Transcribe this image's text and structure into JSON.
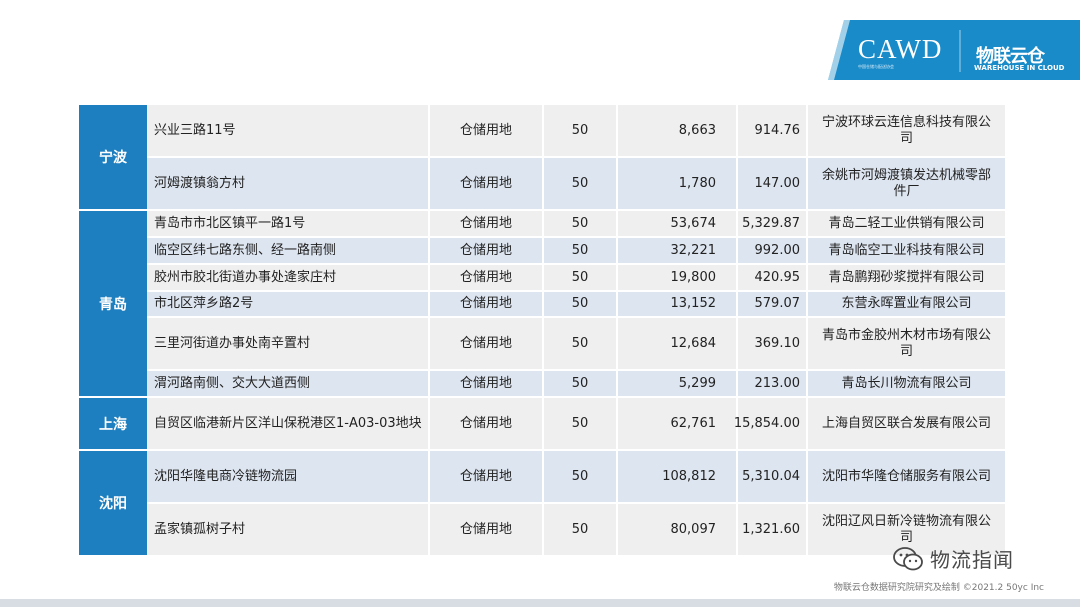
{
  "header": {
    "logo_main": "CAWD",
    "logo_sub": "中国仓储与配送协会",
    "brand_cn": "物联云仓",
    "brand_en": "WAREHOUSE IN CLOUD"
  },
  "table": {
    "groups": [
      {
        "city": "宁波",
        "rows": [
          {
            "address": "兴业三路11号",
            "use": "仓储用地",
            "years": "50",
            "area": "8,663",
            "price": "914.76",
            "company": "宁波环球云连信息科技有限公司"
          },
          {
            "address": "河姆渡镇翁方村",
            "use": "仓储用地",
            "years": "50",
            "area": "1,780",
            "price": "147.00",
            "company": "余姚市河姆渡镇发达机械零部件厂"
          }
        ]
      },
      {
        "city": "青岛",
        "rows": [
          {
            "address": "青岛市市北区镇平一路1号",
            "use": "仓储用地",
            "years": "50",
            "area": "53,674",
            "price": "5,329.87",
            "company": "青岛二轻工业供销有限公司"
          },
          {
            "address": "临空区纬七路东侧、经一路南侧",
            "use": "仓储用地",
            "years": "50",
            "area": "32,221",
            "price": "992.00",
            "company": "青岛临空工业科技有限公司"
          },
          {
            "address": "胶州市胶北街道办事处逄家庄村",
            "use": "仓储用地",
            "years": "50",
            "area": "19,800",
            "price": "420.95",
            "company": "青岛鹏翔砂浆搅拌有限公司"
          },
          {
            "address": "市北区萍乡路2号",
            "use": "仓储用地",
            "years": "50",
            "area": "13,152",
            "price": "579.07",
            "company": "东营永晖置业有限公司"
          },
          {
            "address": "三里河街道办事处南辛置村",
            "use": "仓储用地",
            "years": "50",
            "area": "12,684",
            "price": "369.10",
            "company": "青岛市金胶州木材市场有限公司"
          },
          {
            "address": "渭河路南侧、交大大道西侧",
            "use": "仓储用地",
            "years": "50",
            "area": "5,299",
            "price": "213.00",
            "company": "青岛长川物流有限公司"
          }
        ]
      },
      {
        "city": "上海",
        "rows": [
          {
            "address": "自贸区临港新片区洋山保税港区1-A03-03地块",
            "use": "仓储用地",
            "years": "50",
            "area": "62,761",
            "price": "15,854.00",
            "company": "上海自贸区联合发展有限公司"
          }
        ]
      },
      {
        "city": "沈阳",
        "rows": [
          {
            "address": "沈阳华隆电商冷链物流园",
            "use": "仓储用地",
            "years": "50",
            "area": "108,812",
            "price": "5,310.04",
            "company": "沈阳市华隆仓储服务有限公司"
          },
          {
            "address": "孟家镇孤树子村",
            "use": "仓储用地",
            "years": "50",
            "area": "80,097",
            "price": "1,321.60",
            "company": "沈阳辽风日新冷链物流有限公司"
          }
        ]
      }
    ]
  },
  "watermark": {
    "text": "物流指闻"
  },
  "footer": {
    "credit": "物联云仓数据研究院研究及绘制    ©2021.2 50yc Inc"
  },
  "colors": {
    "accent": "#1d7fbf",
    "row_light": "#efefef",
    "row_blue": "#dde5f0"
  }
}
